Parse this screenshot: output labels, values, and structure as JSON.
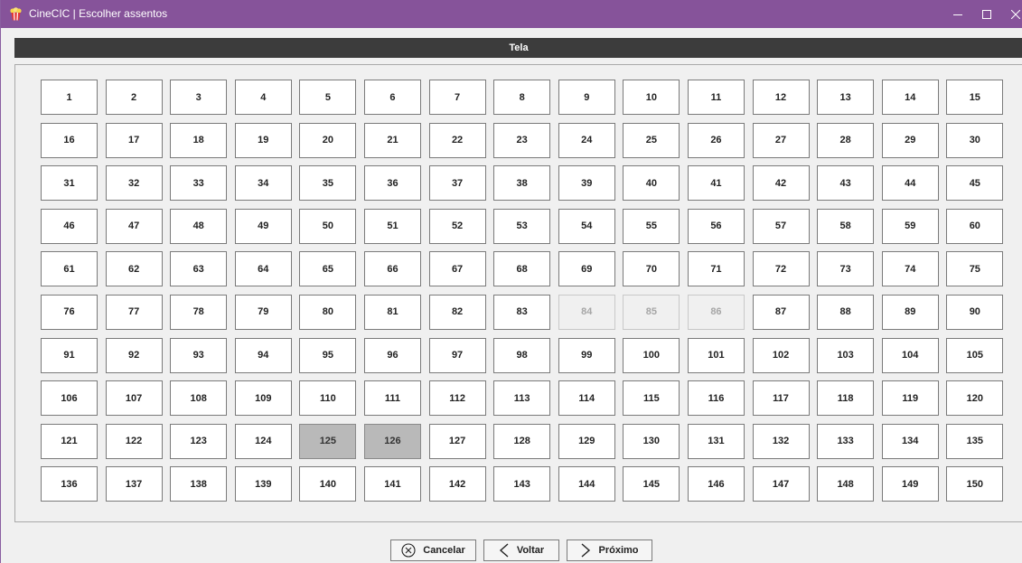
{
  "window": {
    "title": "CineCIC | Escolher assentos",
    "min_glyph": "–",
    "max_glyph": "☐",
    "close_glyph": "✕"
  },
  "screen_label": "Tela",
  "seats": {
    "rows": 10,
    "columns": 15,
    "total": 150,
    "unavailable": [
      84,
      85,
      86
    ],
    "selected": [
      125,
      126
    ]
  },
  "buttons": {
    "cancel": "Cancelar",
    "back": "Voltar",
    "next": "Próximo"
  },
  "colors": {
    "titlebar": "#86539a",
    "screen_bar": "#3c3c3c",
    "seat_selected": "#b9b9b9",
    "seat_unavailable": "#f0f0f0"
  }
}
